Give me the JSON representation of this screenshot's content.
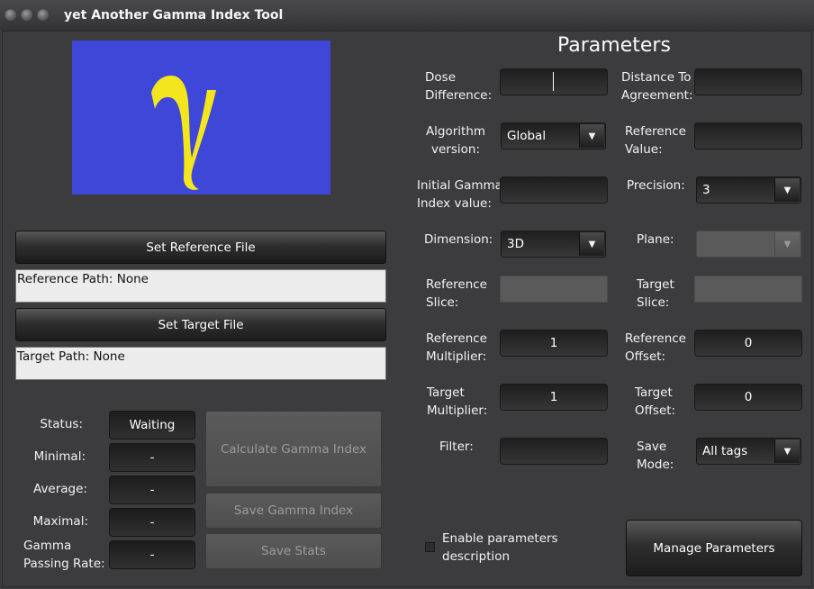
{
  "window": {
    "title": "yet Another Gamma Index Tool"
  },
  "logo": {
    "symbol": "γ",
    "bg_color": "#3f47d8",
    "symbol_color": "#f4e61c"
  },
  "files": {
    "set_reference_label": "Set Reference File",
    "reference_path": "Reference Path: None",
    "set_target_label": "Set Target File",
    "target_path": "Target Path: None"
  },
  "stats": {
    "status_label": "Status:",
    "status_value": "Waiting",
    "minimal_label": "Minimal:",
    "minimal_value": "-",
    "average_label": "Average:",
    "average_value": "-",
    "maximal_label": "Maximal:",
    "maximal_value": "-",
    "passing_label_1": "Gamma",
    "passing_label_2": "Passing Rate:",
    "passing_value": "-"
  },
  "actions": {
    "calculate": "Calculate Gamma Index",
    "save_gamma": "Save Gamma Index",
    "save_stats": "Save Stats"
  },
  "params": {
    "title": "Parameters",
    "dose_diff_1": "Dose",
    "dose_diff_2": "Difference:",
    "dose_diff_value": "",
    "dta_1": "Distance To",
    "dta_2": "Agreement:",
    "dta_value": "",
    "algo_1": "Algorithm",
    "algo_2": "version:",
    "algo_value": "Global",
    "refval_1": "Reference",
    "refval_2": "Value:",
    "refval_value": "",
    "initgamma_1": "Initial Gamma",
    "initgamma_2": "Index value:",
    "initgamma_value": "",
    "precision_label": "Precision:",
    "precision_value": "3",
    "dimension_label": "Dimension:",
    "dimension_value": "3D",
    "plane_label": "Plane:",
    "plane_value": "",
    "refslice_1": "Reference",
    "refslice_2": "Slice:",
    "refslice_value": "",
    "targslice_1": "Target",
    "targslice_2": "Slice:",
    "targslice_value": "",
    "refmult_1": "Reference",
    "refmult_2": "Multiplier:",
    "refmult_value": "1",
    "refoff_1": "Reference",
    "refoff_2": "Offset:",
    "refoff_value": "0",
    "targmult_1": "Target",
    "targmult_2": "Multiplier:",
    "targmult_value": "1",
    "targoff_1": "Target",
    "targoff_2": "Offset:",
    "targoff_value": "0",
    "filter_label": "Filter:",
    "filter_value": "",
    "savemode_1": "Save",
    "savemode_2": "Mode:",
    "savemode_value": "All tags",
    "enable_desc_1": "Enable parameters",
    "enable_desc_2": "description",
    "manage": "Manage Parameters"
  }
}
